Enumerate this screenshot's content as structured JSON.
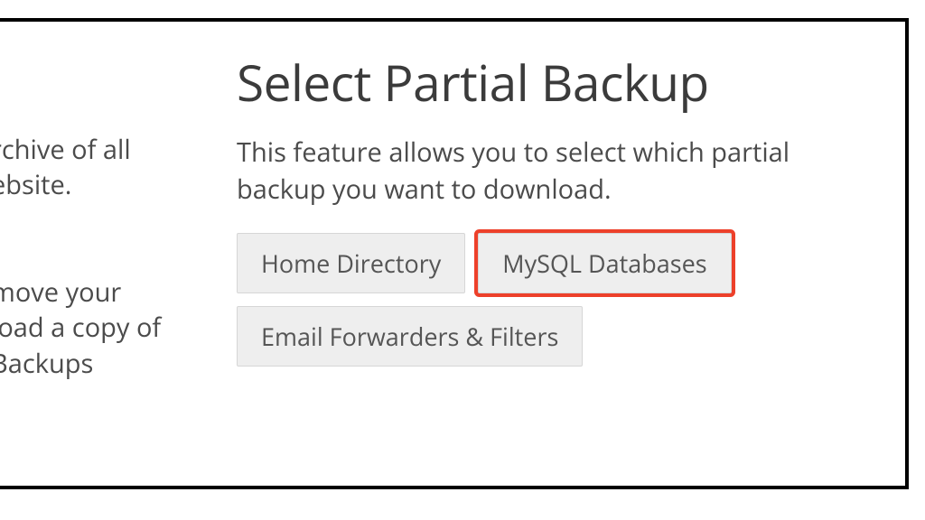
{
  "left": {
    "p1_line1": "rchive of all",
    "p1_line2": "ebsite.",
    "p2_line1": "move your",
    "p2_line2": "load a copy of",
    "p2_line3": " Backups"
  },
  "right": {
    "heading": "Select Partial Backup",
    "description": "This feature allows you to select which partial backup you want to download.",
    "buttons": {
      "home_dir": "Home Directory",
      "mysql": "MySQL Databases",
      "email": "Email Forwarders & Filters"
    }
  }
}
